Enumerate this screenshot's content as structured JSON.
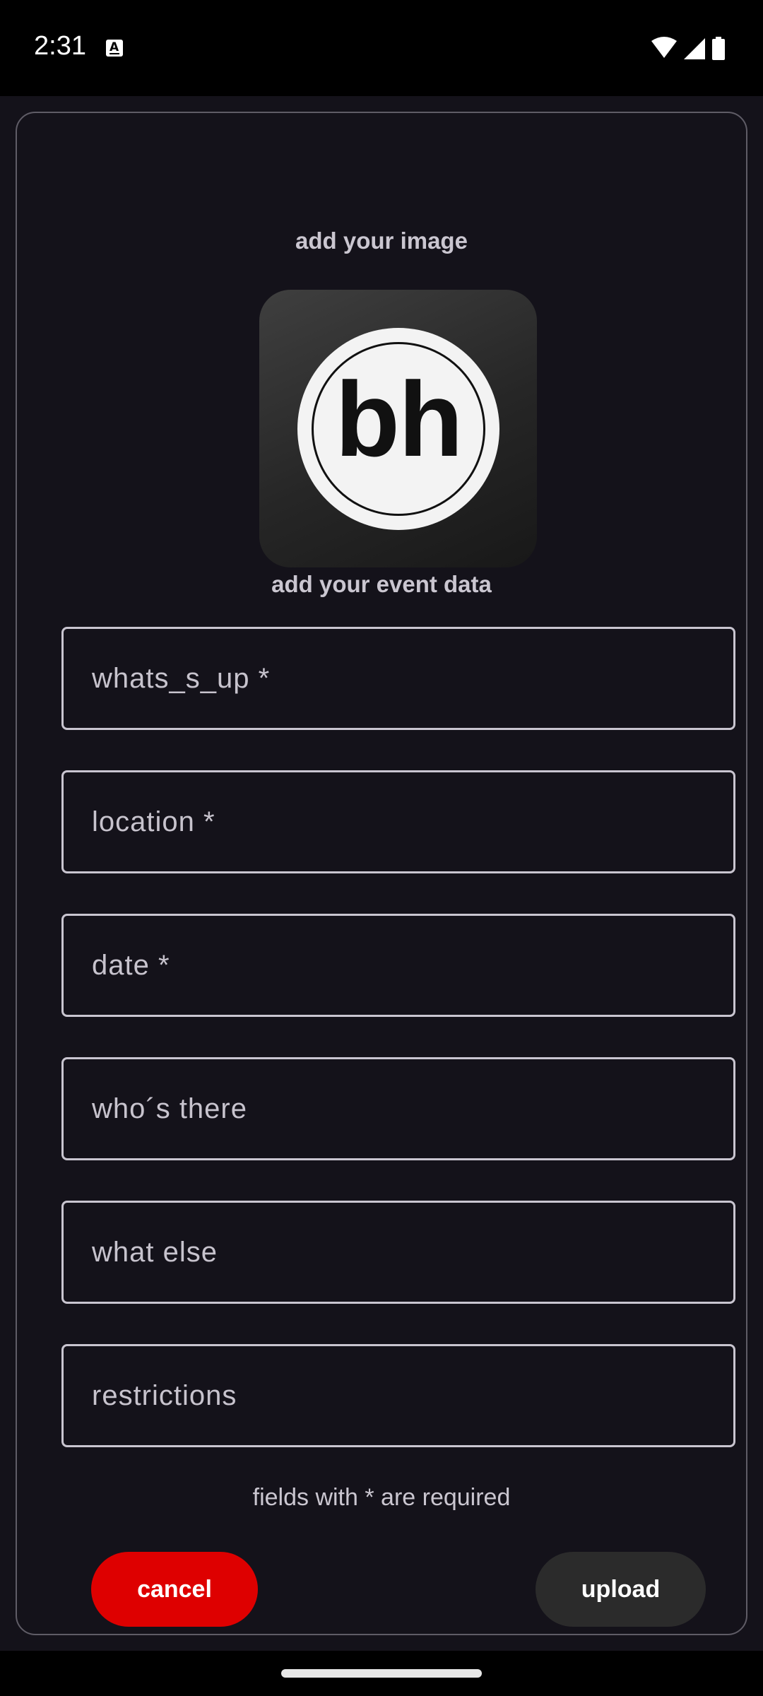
{
  "status_bar": {
    "time": "2:31",
    "notification_icon": "text-a-icon",
    "icons": [
      "wifi-icon",
      "cellular-signal-icon",
      "battery-icon"
    ]
  },
  "form": {
    "image_heading": "add your image",
    "logo_text": "bh",
    "data_heading": "add your event data",
    "fields": [
      {
        "placeholder": "whats_s_up *",
        "value": ""
      },
      {
        "placeholder": "location *",
        "value": ""
      },
      {
        "placeholder": "date *",
        "value": ""
      },
      {
        "placeholder": "who´s there",
        "value": ""
      },
      {
        "placeholder": "what else",
        "value": ""
      },
      {
        "placeholder": "restrictions",
        "value": ""
      }
    ],
    "required_hint": "fields with * are required",
    "cancel_label": "cancel",
    "upload_label": "upload"
  },
  "colors": {
    "background": "#14121a",
    "cancel_button": "#de0000",
    "upload_button": "#2b2b2b",
    "field_border": "#c9c5d0"
  }
}
